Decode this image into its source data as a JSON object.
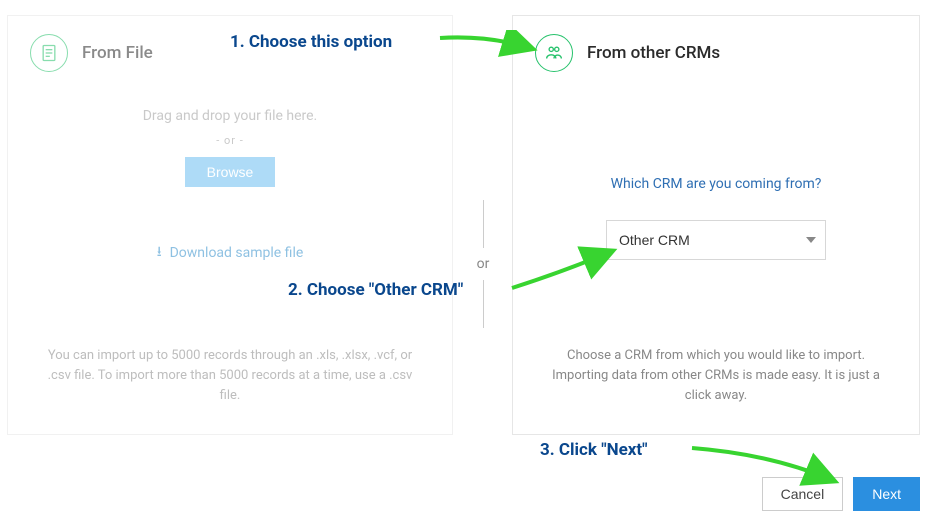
{
  "left": {
    "title": "From File",
    "drop_text": "Drag and drop your file here.",
    "or": "-  or  -",
    "browse": "Browse",
    "download": "Download sample file",
    "help": "You can import up to 5000 records through an .xls, .xlsx, .vcf, or .csv file. To import more than 5000 records at a time, use a .csv file."
  },
  "right": {
    "title": "From other CRMs",
    "question": "Which CRM are you coming from?",
    "selected": "Other CRM",
    "help": "Choose a CRM from which you would like to import. Importing data from other CRMs is made easy. It is just a click away."
  },
  "divider": {
    "or": "or"
  },
  "footer": {
    "cancel": "Cancel",
    "next": "Next"
  },
  "anno": {
    "a1": "1. Choose this option",
    "a2": "2. Choose \"Other CRM\"",
    "a3": "3. Click \"Next\""
  }
}
